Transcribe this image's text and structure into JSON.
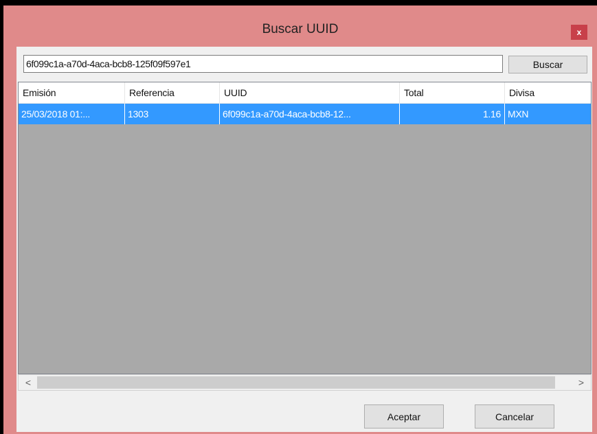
{
  "window": {
    "title": "Buscar UUID",
    "close_label": "x"
  },
  "search": {
    "value": "6f099c1a-a70d-4aca-bcb8-125f09f597e1",
    "button_label": "Buscar"
  },
  "table": {
    "columns": [
      "Emisión",
      "Referencia",
      "UUID",
      "Total",
      "Divisa"
    ],
    "rows": [
      {
        "emision": "25/03/2018 01:...",
        "referencia": "1303",
        "uuid": "6f099c1a-a70d-4aca-bcb8-12...",
        "total": "1.16",
        "divisa": "MXN",
        "selected": true
      }
    ]
  },
  "scrollbar": {
    "left_arrow": "<",
    "right_arrow": ">"
  },
  "footer": {
    "ok_label": "Aceptar",
    "cancel_label": "Cancelar"
  },
  "colors": {
    "titlebar": "#e08a8a",
    "selection": "#3399ff",
    "close_button": "#c8404a"
  }
}
